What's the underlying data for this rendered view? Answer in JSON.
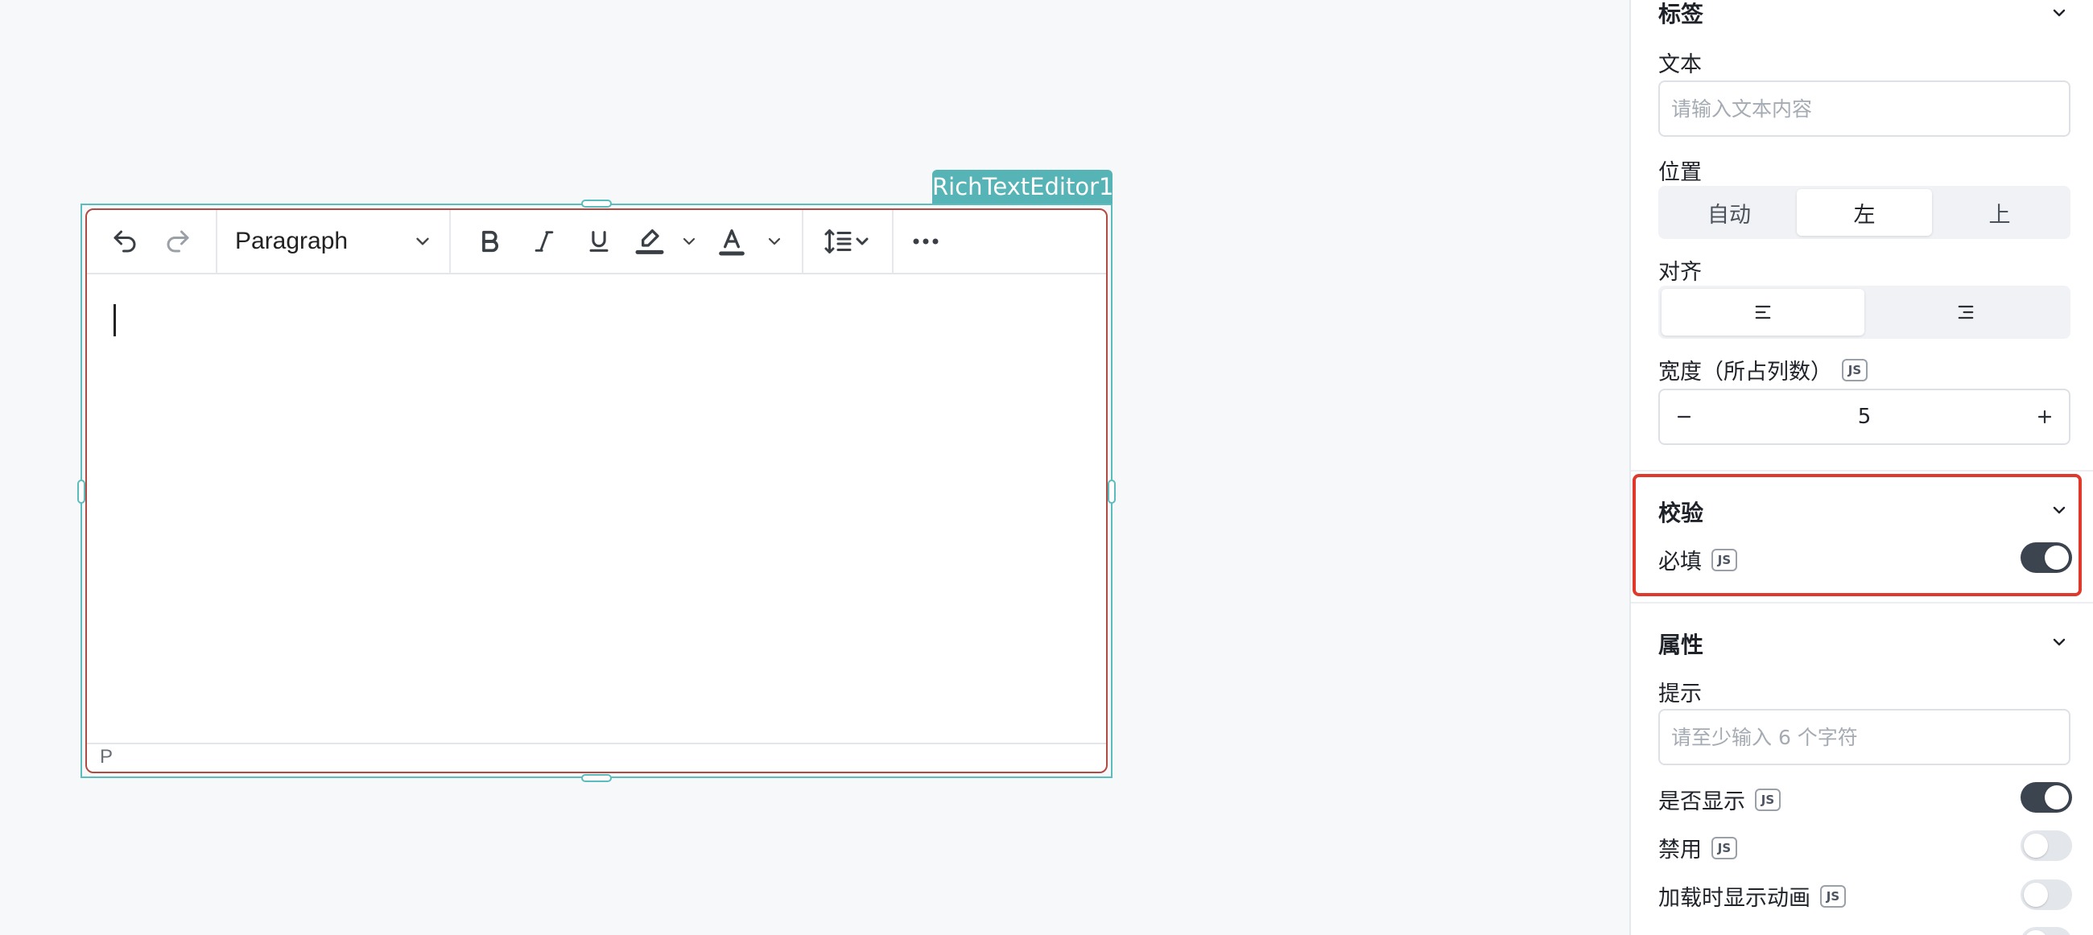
{
  "component": {
    "tag": "RichTextEditor1"
  },
  "editor": {
    "toolbar": {
      "undo_icon": "undo-icon",
      "redo_icon": "redo-icon",
      "block_format": "Paragraph",
      "bold_icon": "bold-icon",
      "italic_icon": "italic-icon",
      "underline_icon": "underline-icon",
      "highlight_icon": "highlighter-icon",
      "text_color_icon": "text-color-icon",
      "line_height_icon": "line-height-icon",
      "more_icon": "more-icon"
    },
    "status_path": "P"
  },
  "panel": {
    "label_section": {
      "title": "标签",
      "text_label": "文本",
      "text_placeholder": "请输入文本内容",
      "position_label": "位置",
      "position_options": [
        "自动",
        "左",
        "上"
      ],
      "position_selected": "左",
      "align_label": "对齐",
      "align_options": [
        "align-left-icon",
        "align-right-icon"
      ],
      "width_label": "宽度（所占列数）",
      "width_value": "5",
      "js_badge": "JS"
    },
    "validation_section": {
      "title": "校验",
      "required_label": "必填",
      "required_on": true,
      "js_badge": "JS"
    },
    "attributes_section": {
      "title": "属性",
      "hint_label": "提示",
      "hint_placeholder": "请至少输入 6 个字符",
      "visible_label": "是否显示",
      "visible_on": true,
      "disabled_label": "禁用",
      "disabled_on": false,
      "loading_anim_label": "加载时显示动画",
      "loading_anim_on": false,
      "js_badge": "JS"
    }
  },
  "colors": {
    "selection": "#5bbcbd",
    "tag_bg": "#56b4b6",
    "editor_border": "#b24a44",
    "highlight_border": "#e0392b",
    "toggle_on": "#3c4450"
  }
}
